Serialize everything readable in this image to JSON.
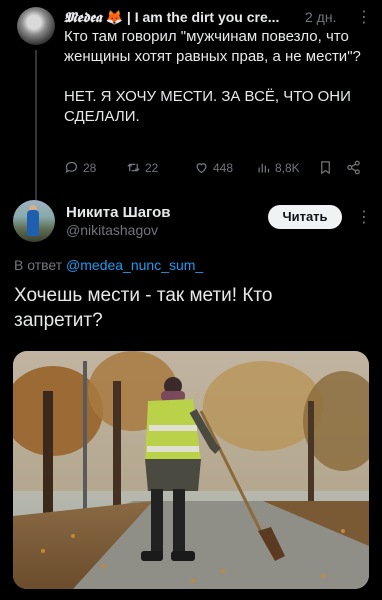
{
  "tweet1": {
    "name_styled": "𝕸𝖊𝖉𝖊𝖆",
    "emoji": "🦊",
    "name_tail": "| I am the dirt you cre...",
    "time": "2 дн.",
    "body": "Кто там говорил \"мужчинам повезло, что женщины хотят равных прав, а не мести\"?\n\nНЕТ. Я ХОЧУ МЕСТИ. ЗА ВСЁ, ЧТО ОНИ СДЕЛАЛИ.",
    "stats": {
      "replies": "28",
      "retweets": "22",
      "likes": "448",
      "views": "8,8K"
    }
  },
  "tweet2": {
    "name": "Никита Шагов",
    "handle": "@nikitashagov",
    "follow_label": "Читать",
    "reply_prefix": "В ответ",
    "reply_handle": "@medea_nunc_sum_",
    "text": "Хочешь мести - так мети! Кто запретит?"
  },
  "icons": [
    "more-icon",
    "reply-icon",
    "retweet-icon",
    "like-icon",
    "views-icon",
    "bookmark-icon",
    "share-icon"
  ],
  "colors": {
    "background": "#000000",
    "text": "#e7e9ea",
    "muted": "#71767b",
    "link": "#1d9bf0",
    "fox": "#ff7a1a"
  }
}
